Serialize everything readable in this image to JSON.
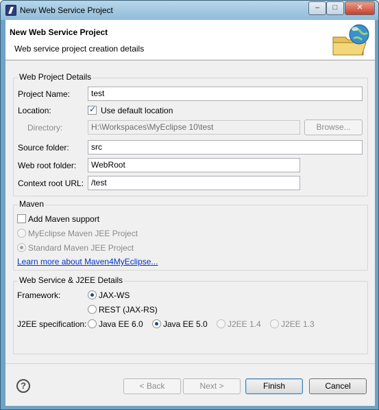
{
  "window": {
    "title": "New Web Service Project",
    "minimize_glyph": "–",
    "maximize_glyph": "□",
    "close_glyph": "✕"
  },
  "header": {
    "title": "New Web Service Project",
    "subtitle": "Web service project creation details",
    "icon": "folder-globe-icon"
  },
  "web_project": {
    "group_label": "Web Project Details",
    "project_name_label": "Project Name:",
    "project_name_value": "test",
    "location_label": "Location:",
    "use_default_location_label": "Use default location",
    "use_default_location_checked": true,
    "directory_label": "Directory:",
    "directory_value": "H:\\Workspaces\\MyEclipse 10\\test",
    "browse_label": "Browse...",
    "source_folder_label": "Source folder:",
    "source_folder_value": "src",
    "web_root_label": "Web root folder:",
    "web_root_value": "WebRoot",
    "context_root_label": "Context root URL:",
    "context_root_value": "/test"
  },
  "maven": {
    "group_label": "Maven",
    "add_support_label": "Add Maven support",
    "add_support_checked": false,
    "myeclipse_jee_label": "MyEclipse Maven JEE Project",
    "standard_jee_label": "Standard Maven JEE Project",
    "learn_more_link": "Learn more about Maven4MyEclipse..."
  },
  "ws": {
    "group_label": "Web Service & J2EE Details",
    "framework_label": "Framework:",
    "jaxws_label": "JAX-WS",
    "jaxrs_label": "REST (JAX-RS)",
    "j2ee_spec_label": "J2EE specification:",
    "javaee6_label": "Java EE 6.0",
    "javaee5_label": "Java EE 5.0",
    "j2ee14_label": "J2EE 1.4",
    "j2ee13_label": "J2EE 1.3",
    "selected_framework": "JAX-WS",
    "selected_spec": "Java EE 5.0"
  },
  "footer": {
    "help_glyph": "?",
    "back_label": "< Back",
    "next_label": "Next >",
    "finish_label": "Finish",
    "cancel_label": "Cancel"
  }
}
